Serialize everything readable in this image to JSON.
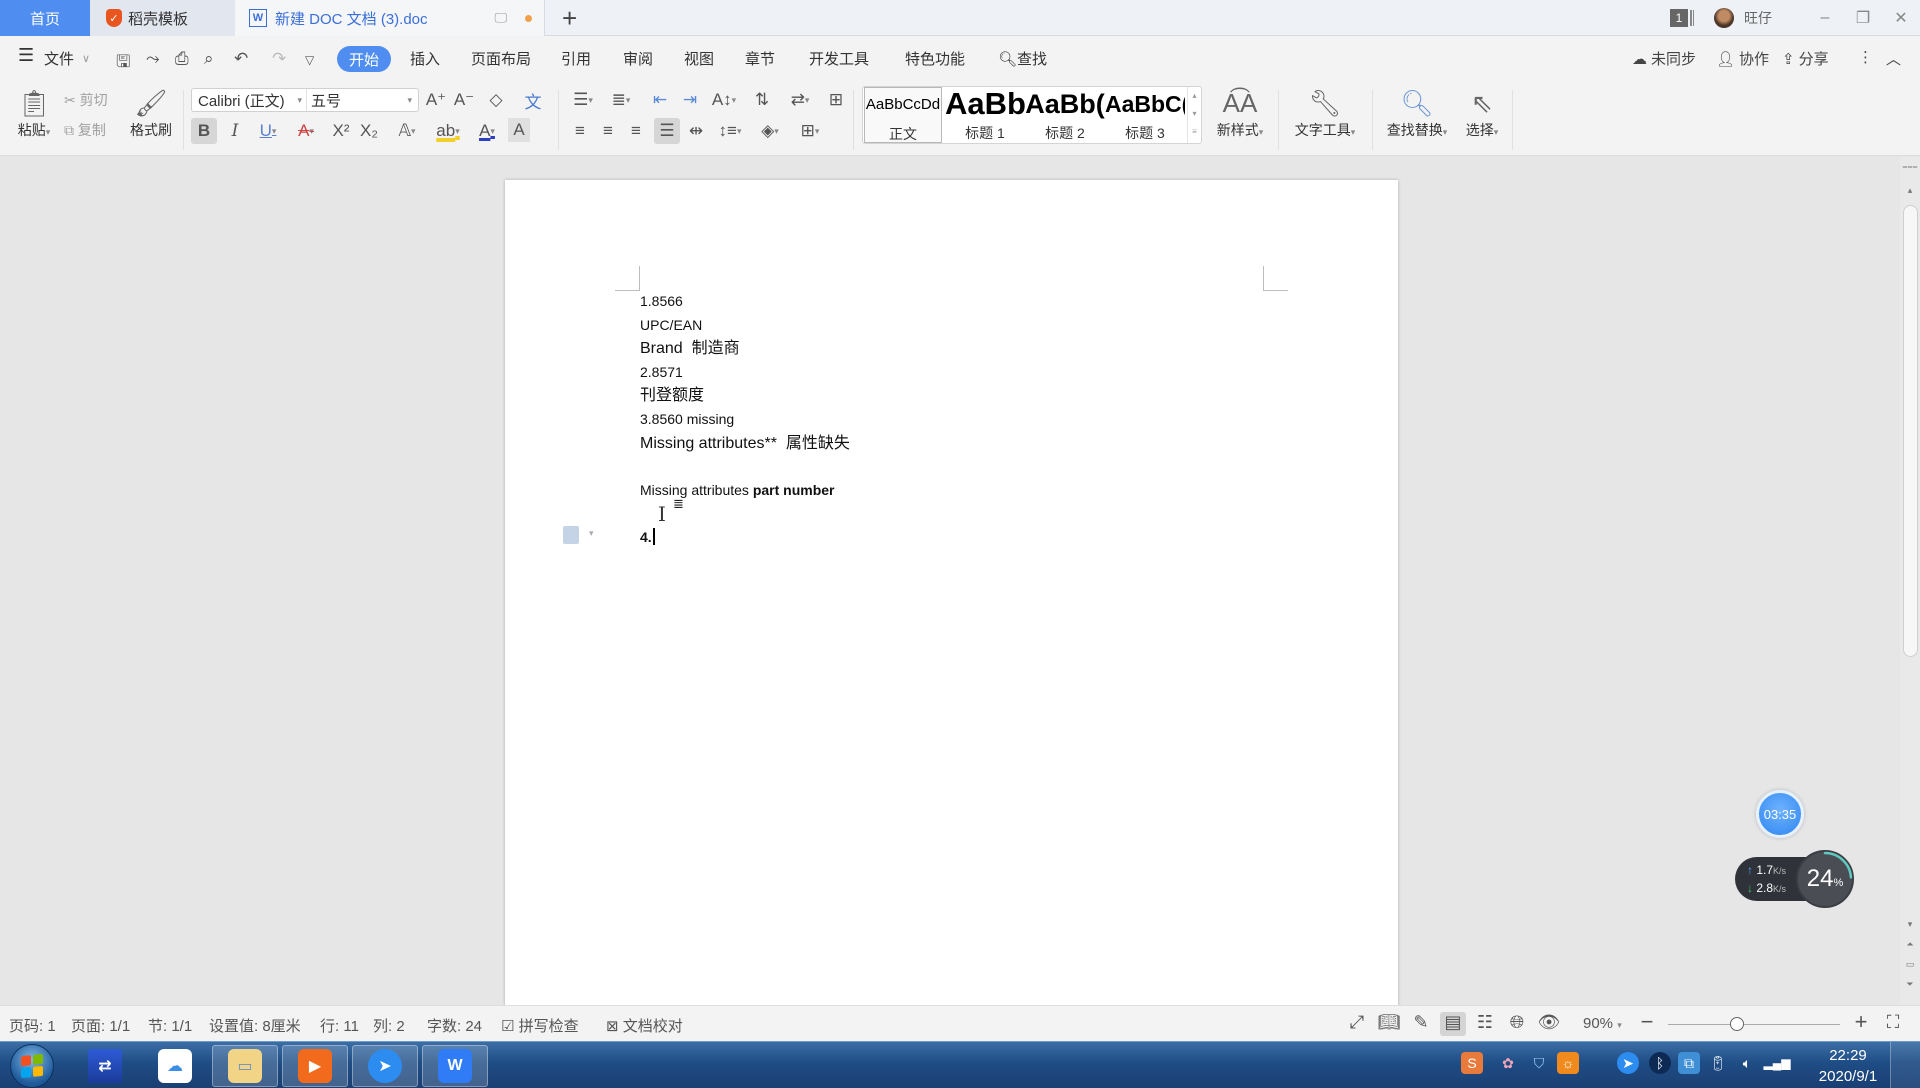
{
  "titlebar": {
    "tabs": [
      {
        "label": "首页"
      },
      {
        "label": "稻壳模板"
      },
      {
        "label": "新建 DOC 文档 (3).doc"
      }
    ],
    "new_tab": "+",
    "window_count": "1",
    "username": "旺仔",
    "minimize": "–",
    "restore": "❐",
    "close": "✕"
  },
  "menubar": {
    "file_label": "文件",
    "tabs": [
      "开始",
      "插入",
      "页面布局",
      "引用",
      "审阅",
      "视图",
      "章节",
      "开发工具",
      "特色功能"
    ],
    "active_tab": "开始",
    "search_label": "查找",
    "right": {
      "sync": "未同步",
      "collab": "协作",
      "share": "分享"
    }
  },
  "ribbon": {
    "paste": "粘贴",
    "cut": "剪切",
    "copy": "复制",
    "format_painter": "格式刷",
    "font_name": "Calibri (正文)",
    "font_size": "五号",
    "styles": [
      {
        "sample": "AaBbCcDd",
        "label": "正文"
      },
      {
        "sample": "AaBb",
        "label": "标题 1"
      },
      {
        "sample": "AaBb(",
        "label": "标题 2"
      },
      {
        "sample": "AaBbC(",
        "label": "标题 3"
      }
    ],
    "new_style": "新样式",
    "text_tools": "文字工具",
    "find_replace": "查找替换",
    "select": "选择"
  },
  "document": {
    "lines": [
      {
        "text": "1.8566",
        "cn": false
      },
      {
        "text": "UPC/EAN",
        "cn": false
      },
      {
        "text": "Brand  制造商",
        "cn": true
      },
      {
        "text": "2.8571",
        "cn": false
      },
      {
        "text": "刊登额度",
        "cn": true
      },
      {
        "text": "3.8560 missing",
        "cn": false
      },
      {
        "text": "Missing attributes**  属性缺失",
        "cn": true
      },
      {
        "text": "",
        "cn": false
      }
    ],
    "line_part_prefix": "Missing attributes ",
    "line_part_bold": "part number",
    "current_line": "4."
  },
  "widgets": {
    "timer": "03:35",
    "upload_speed": "1.7",
    "download_speed": "2.8",
    "speed_unit": "K/s",
    "cpu_percent": 24,
    "cpu_label": "24",
    "percent_sign": "%"
  },
  "statusbar": {
    "page_num": "页码: 1",
    "pages": "页面: 1/1",
    "section": "节: 1/1",
    "setting": "设置值: 8厘米",
    "row": "行: 11",
    "col": "列: 2",
    "word_count": "字数: 24",
    "spell_check": "拼写检查",
    "doc_proof": "文档校对",
    "zoom_level": "90%",
    "zoom_fraction": 0.4
  },
  "taskbar": {
    "time": "22:29",
    "date": "2020/9/1"
  }
}
